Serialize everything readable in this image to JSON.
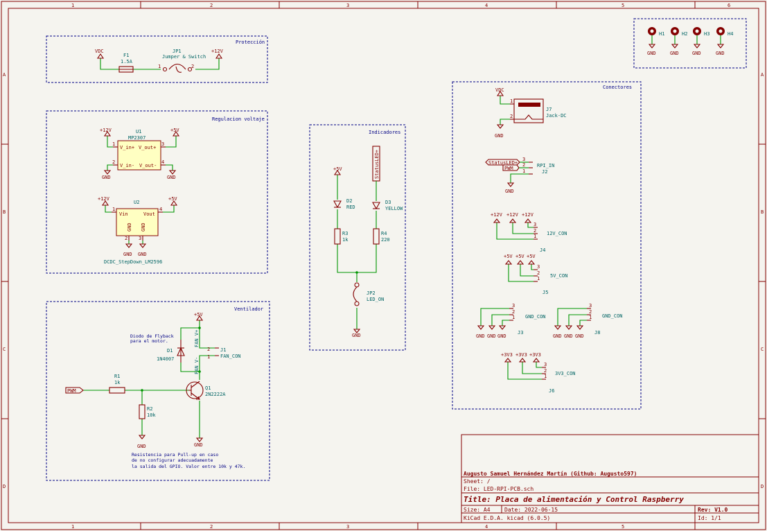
{
  "grid": {
    "top": [
      "1",
      "2",
      "3",
      "4",
      "5",
      "6"
    ],
    "left": [
      "A",
      "B",
      "C",
      "D"
    ]
  },
  "sections": {
    "proteccion": "Protección",
    "regulacion": "Regulacion voltaje",
    "ventilador": "Ventilador",
    "indicadores": "Indicadores",
    "conectores": "Conectores"
  },
  "power": {
    "vdc": "VDC",
    "p12": "+12V",
    "p5": "+5V",
    "gnd": "GND",
    "p3v3": "+3V3"
  },
  "fuse": {
    "ref": "F1",
    "value": "1.5A"
  },
  "jp1": {
    "ref": "JP1",
    "value": "Jumper & Switch",
    "pin1": "1",
    "pin2": "2"
  },
  "u1": {
    "ref": "U1",
    "value": "MP2307",
    "in_p": "V_in+",
    "out_p": "V_out+",
    "in_m": "V_in-",
    "out_m": "V_out-",
    "p1": "1",
    "p2": "2",
    "p3": "3",
    "p4": "4"
  },
  "u2": {
    "ref": "U2",
    "value": "DCDC_StepDown_LM2596",
    "vin": "Vin",
    "vout": "Vout",
    "gnd": "GND",
    "p1": "1",
    "p2": "2",
    "p3": "3",
    "p4": "4"
  },
  "ventilador": {
    "d1_ref": "D1",
    "d1_val": "1N4007",
    "note1": "Diodo de Flyback",
    "note2": "para el motor.",
    "fan_p": "FAN_V+",
    "fan_m": "FAN_V-",
    "j1_ref": "J1",
    "j1_val": "FAN_CON",
    "r1_ref": "R1",
    "r1_val": "1k",
    "r2_ref": "R2",
    "r2_val": "10k",
    "q1_ref": "Q1",
    "q1_val": "2N2222A",
    "pwm": "PWM",
    "note3": "Resistencia para Pull-up en caso",
    "note4": "de no configurar adecuadamente",
    "note5": "la salida del GPIO. Valor entre 10k y 47k."
  },
  "indicadores": {
    "status": "StatusLED+",
    "d2_ref": "D2",
    "d2_val": "RED",
    "d3_ref": "D3",
    "d3_val": "YELLOW",
    "r3_ref": "R3",
    "r3_val": "1k",
    "r4_ref": "R4",
    "r4_val": "220",
    "jp2_ref": "JP2",
    "jp2_val": "LED_ON"
  },
  "mounting": [
    "H1",
    "H2",
    "H3",
    "H4"
  ],
  "conectores": {
    "j7_ref": "J7",
    "j7_val": "Jack-DC",
    "j2_ref": "J2",
    "j2_val": "RPI_IN",
    "status": "StatusLED+",
    "pwm": "PWM",
    "j4_ref": "J4",
    "j4_val": "12V_CON",
    "j5_ref": "J5",
    "j5_val": "5V_CON",
    "j3_ref": "J3",
    "j3_val": "GND_CON",
    "j8_ref": "J8",
    "j8_val": "GND_CON",
    "j6_ref": "J6",
    "j6_val": "3V3_CON"
  },
  "title_block": {
    "author": "Augusto Samuel Hernández Martín (Github: Augusto597)",
    "sheet": "Sheet: /",
    "file": "File: LED-RPI-PCB.sch",
    "title": "Title: Placa de alimentación y Control Raspberry",
    "size": "Size: A4",
    "date": "Date: 2022-06-15",
    "rev": "Rev: V1.0",
    "kicad": "KiCad E.D.A.  kicad (6.0.5)",
    "id": "Id: 1/1"
  }
}
